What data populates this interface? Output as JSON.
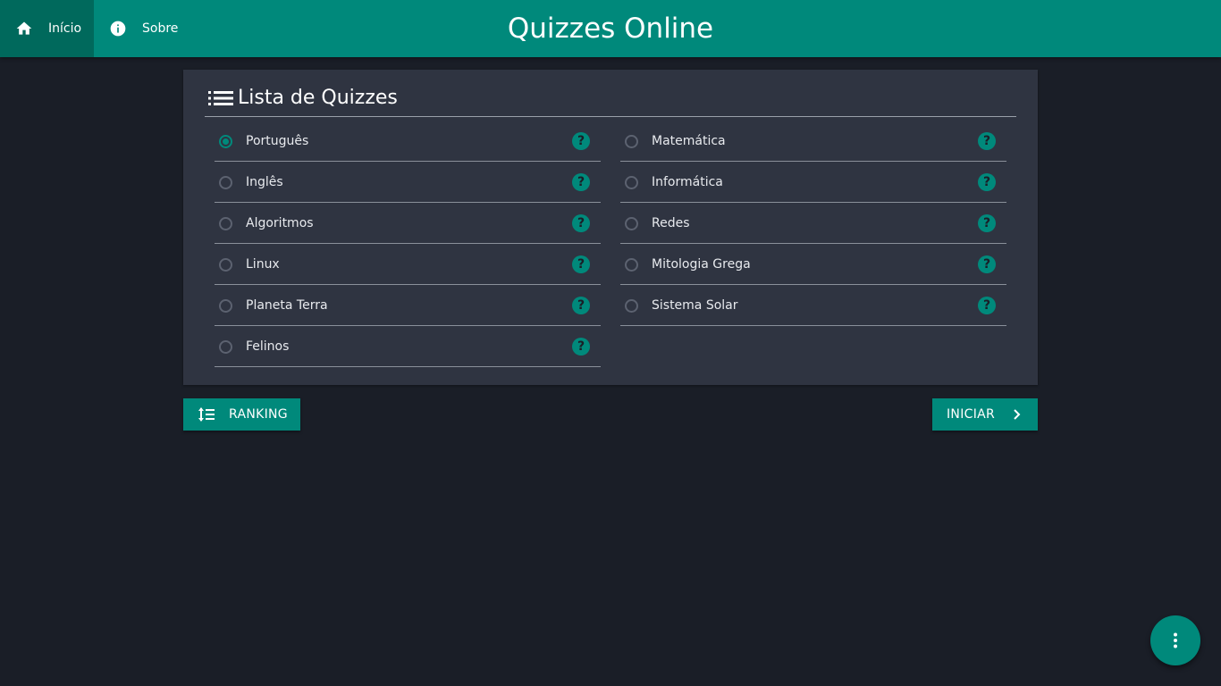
{
  "nav": {
    "home_label": "Início",
    "about_label": "Sobre"
  },
  "app": {
    "title": "Quizzes Online"
  },
  "panel": {
    "title": "Lista de Quizzes"
  },
  "quizzes": {
    "left": [
      {
        "label": "Português",
        "selected": true
      },
      {
        "label": "Inglês",
        "selected": false
      },
      {
        "label": "Algoritmos",
        "selected": false
      },
      {
        "label": "Linux",
        "selected": false
      },
      {
        "label": "Planeta Terra",
        "selected": false
      },
      {
        "label": "Felinos",
        "selected": false
      }
    ],
    "right": [
      {
        "label": "Matemática",
        "selected": false
      },
      {
        "label": "Informática",
        "selected": false
      },
      {
        "label": "Redes",
        "selected": false
      },
      {
        "label": "Mitologia Grega",
        "selected": false
      },
      {
        "label": "Sistema Solar",
        "selected": false
      }
    ],
    "help_glyph": "?"
  },
  "buttons": {
    "ranking_label": "RANKING",
    "start_label": "INICIAR"
  },
  "icons": {
    "home": "home-icon",
    "about": "info-icon",
    "list": "list-icon",
    "ranking": "sort-list-icon",
    "start": "chevron-right-icon",
    "fab": "more-vertical-icon",
    "help": "help-circle-icon"
  },
  "colors": {
    "accent": "#00897b",
    "accent_dark": "#00695c",
    "background": "#1a1e27",
    "panel": "#2f3441"
  }
}
